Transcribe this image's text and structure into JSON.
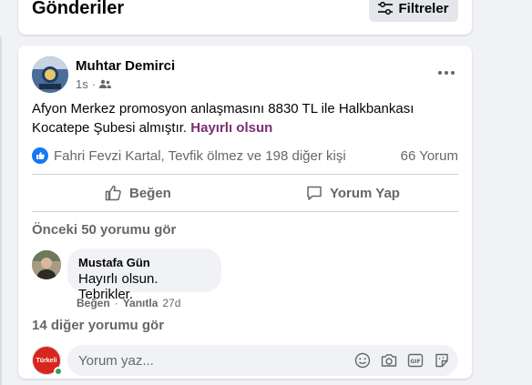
{
  "header": {
    "title": "Gönderiler",
    "filter_label": "Filtreler"
  },
  "post": {
    "author": "Muhtar Demirci",
    "time": "1s",
    "audience_icon": "friends-icon",
    "text_main": "Afyon Merkez promosyon anlaşmasını 8830 TL ile Halkbankası Kocatepe Şubesi  almıştır. ",
    "hashtag": "Hayırlı olsun",
    "reactions": {
      "names": "Fahri Fevzi Kartal, Tevfik ölmez ve 198 diğer kişi",
      "comment_count": "66 Yorum"
    },
    "actions": {
      "like": "Beğen",
      "comment": "Yorum Yap"
    },
    "previous_comments": "Önceki 50 yorumu gör",
    "comment": {
      "author": "Mustafa Gün",
      "text": "Hayırlı olsun. Tebrikler.",
      "like": "Beğen",
      "sep": "·",
      "reply": "Yanıtla",
      "age": "27d"
    },
    "more_comments": "14 diğer yorumu gör",
    "composer": {
      "placeholder": "Yorum yaz...",
      "avatar_text": "Türkeli"
    }
  },
  "colors": {
    "accent": "#1877f2",
    "hashtag": "#7a2d72",
    "online": "#31a24c"
  }
}
